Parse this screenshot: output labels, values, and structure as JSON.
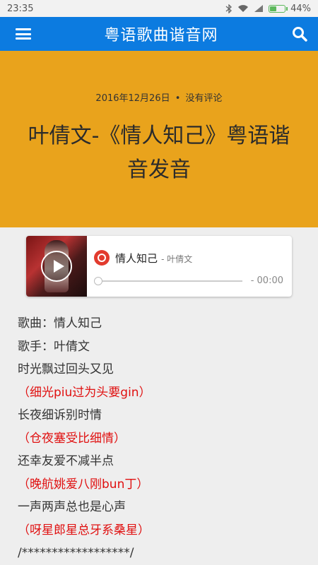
{
  "status_bar": {
    "time": "23:35",
    "battery": "44%",
    "battery_level": 0.44
  },
  "navbar": {
    "title": "粤语歌曲谐音网"
  },
  "post": {
    "date": "2016年12月26日",
    "separator": "•",
    "comments": "没有评论",
    "title": "叶倩文-《情人知己》粤语谐音发音"
  },
  "player": {
    "song": "情人知己",
    "artist": "- 叶倩文",
    "time": "- 00:00"
  },
  "lyrics": [
    {
      "text": "歌曲：情人知己",
      "color": "#333333"
    },
    {
      "text": "歌手：叶倩文",
      "color": "#333333"
    },
    {
      "text": "时光飘过回头又见",
      "color": "#333333"
    },
    {
      "text": "（细光piu过为头要gin）",
      "color": "#e01010"
    },
    {
      "text": "长夜细诉别时情",
      "color": "#333333"
    },
    {
      "text": "（仓夜塞受比细情）",
      "color": "#e01010"
    },
    {
      "text": "还幸友爱不减半点",
      "color": "#333333"
    },
    {
      "text": "（晚航姚爱八刚bun丁）",
      "color": "#e01010"
    },
    {
      "text": "一声两声总也是心声",
      "color": "#333333"
    },
    {
      "text": "（呀星郎星总牙系桑星）",
      "color": "#e01010"
    },
    {
      "text": "/******************/",
      "color": "#333333"
    }
  ]
}
